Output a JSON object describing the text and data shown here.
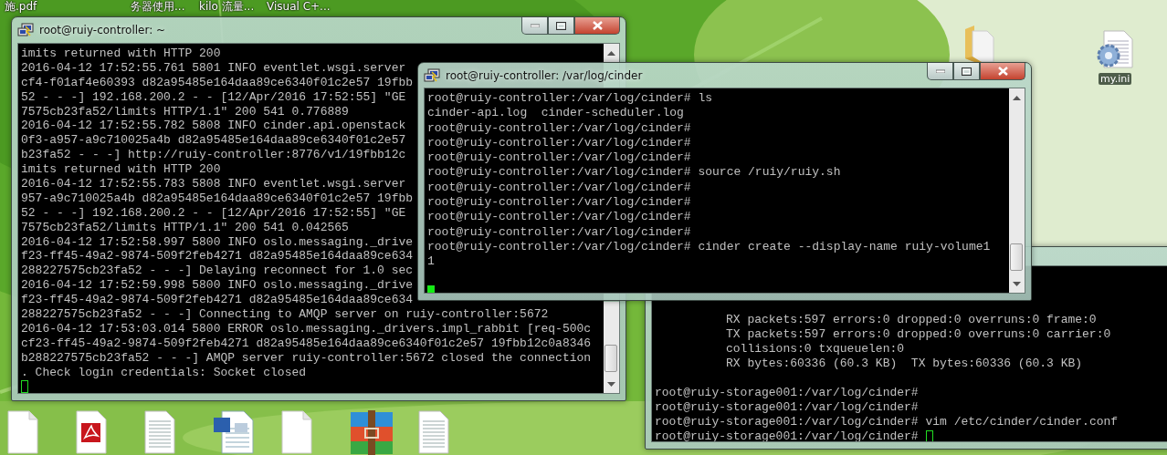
{
  "desktop": {
    "top_labels": [
      "施.pdf",
      "务器使用...",
      "kilo 流量...",
      "Visual C+..."
    ],
    "bottom_icons": [
      {
        "kind": "blank-doc"
      },
      {
        "kind": "pdf"
      },
      {
        "kind": "text-doc"
      },
      {
        "kind": "word-doc"
      },
      {
        "kind": "blank-doc"
      },
      {
        "kind": "archive"
      },
      {
        "kind": "text-doc"
      }
    ],
    "right_icons": [
      {
        "kind": "folder"
      },
      {
        "kind": "settings-file",
        "label": "my.ini"
      }
    ]
  },
  "windows": [
    {
      "title": "root@ruiy-controller: ~",
      "active": false,
      "lines": [
        "imits returned with HTTP 200",
        "2016-04-12 17:52:55.761 5801 INFO eventlet.wsgi.server",
        "cf4-f01af4e60393 d82a95485e164daa89ce6340f01c2e57 19fbb",
        "52 - - -] 192.168.200.2 - - [12/Apr/2016 17:52:55] \"GE",
        "7575cb23fa52/limits HTTP/1.1\" 200 541 0.776889",
        "2016-04-12 17:52:55.782 5808 INFO cinder.api.openstack",
        "0f3-a957-a9c710025a4b d82a95485e164daa89ce6340f01c2e57",
        "b23fa52 - - -] http://ruiy-controller:8776/v1/19fbb12c",
        "imits returned with HTTP 200",
        "2016-04-12 17:52:55.783 5808 INFO eventlet.wsgi.server",
        "957-a9c710025a4b d82a95485e164daa89ce6340f01c2e57 19fbb",
        "52 - - -] 192.168.200.2 - - [12/Apr/2016 17:52:55] \"GE",
        "7575cb23fa52/limits HTTP/1.1\" 200 541 0.042565",
        "2016-04-12 17:52:58.997 5800 INFO oslo.messaging._drive",
        "f23-ff45-49a2-9874-509f2feb4271 d82a95485e164daa89ce634",
        "288227575cb23fa52 - - -] Delaying reconnect for 1.0 sec",
        "2016-04-12 17:52:59.998 5800 INFO oslo.messaging._drive",
        "f23-ff45-49a2-9874-509f2feb4271 d82a95485e164daa89ce634",
        "288227575cb23fa52 - - -] Connecting to AMQP server on ruiy-controller:5672",
        "2016-04-12 17:53:03.014 5800 ERROR oslo.messaging._drivers.impl_rabbit [req-500c",
        "cf23-ff45-49a2-9874-509f2feb4271 d82a95485e164daa89ce6340f01c2e57 19fbb12c0a8346",
        "b288227575cb23fa52 - - -] AMQP server ruiy-controller:5672 closed the connection",
        ". Check login credentials: Socket closed"
      ]
    },
    {
      "title": "root@ruiy-controller: /var/log/cinder",
      "active": true,
      "lines": [
        "root@ruiy-controller:/var/log/cinder# ls",
        "cinder-api.log  cinder-scheduler.log",
        "root@ruiy-controller:/var/log/cinder#",
        "root@ruiy-controller:/var/log/cinder#",
        "root@ruiy-controller:/var/log/cinder#",
        "root@ruiy-controller:/var/log/cinder# source /ruiy/ruiy.sh",
        "root@ruiy-controller:/var/log/cinder#",
        "root@ruiy-controller:/var/log/cinder#",
        "root@ruiy-controller:/var/log/cinder#",
        "root@ruiy-controller:/var/log/cinder#",
        "root@ruiy-controller:/var/log/cinder# cinder create --display-name ruiy-volume1",
        "1"
      ]
    },
    {
      "active": false,
      "interface_lines": [
        "RX packets:597 errors:0 dropped:0 overruns:0 frame:0",
        "TX packets:597 errors:0 dropped:0 overruns:0 carrier:0",
        "collisions:0 txqueuelen:0",
        "RX bytes:60336 (60.3 KB)  TX bytes:60336 (60.3 KB)"
      ],
      "lines": [
        "root@ruiy-storage001:/var/log/cinder#",
        "root@ruiy-storage001:/var/log/cinder#",
        "root@ruiy-storage001:/var/log/cinder# vim /etc/cinder/cinder.conf"
      ],
      "prompt": "root@ruiy-storage001:/var/log/cinder#"
    }
  ]
}
